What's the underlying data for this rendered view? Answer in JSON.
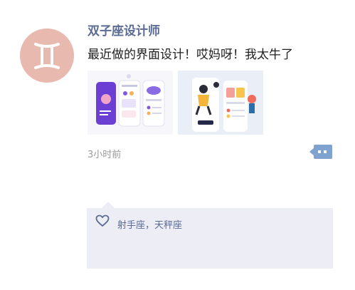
{
  "post": {
    "username": "双子座设计师",
    "text": "最近做的界面设计！哎妈呀！我太牛了",
    "timestamp": "3小时前",
    "avatar_icon": "gemini-zodiac-icon",
    "images": [
      "ui-design-screenshot",
      "illustration-app-screenshot"
    ]
  },
  "likes": {
    "icon": "heart-outline-icon",
    "names": "射手座，天秤座"
  },
  "actions": {
    "more_icon": "comment-more-icon"
  },
  "colors": {
    "avatar_bg": "#e8b9ae",
    "name_color": "#5b6b93",
    "likes_bg": "#ecedf5",
    "action_blue": "#7fa2d0"
  }
}
